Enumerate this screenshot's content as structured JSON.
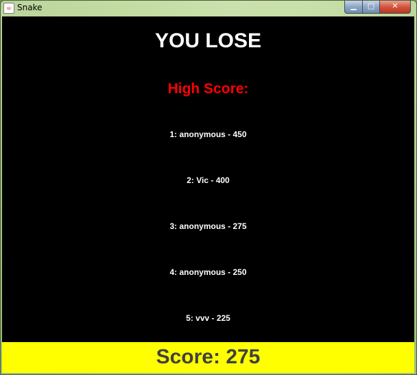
{
  "window": {
    "title": "Snake",
    "icon": "java-coffee-icon",
    "controls": {
      "minimize": "▁",
      "maximize": "□",
      "close": "✕"
    }
  },
  "game": {
    "heading": "YOU LOSE",
    "high_score_title": "High Score:",
    "high_scores": [
      "1: anonymous - 450",
      "2: Vic - 400",
      "3: anonymous - 275",
      "4: anonymous - 250",
      "5: vvv - 225"
    ],
    "score_label": "Score: 275"
  },
  "colors": {
    "background": "#000000",
    "heading": "#ffffff",
    "high_score_title": "#ff0000",
    "score_bar": "#ffff00",
    "score_text": "#404040"
  }
}
